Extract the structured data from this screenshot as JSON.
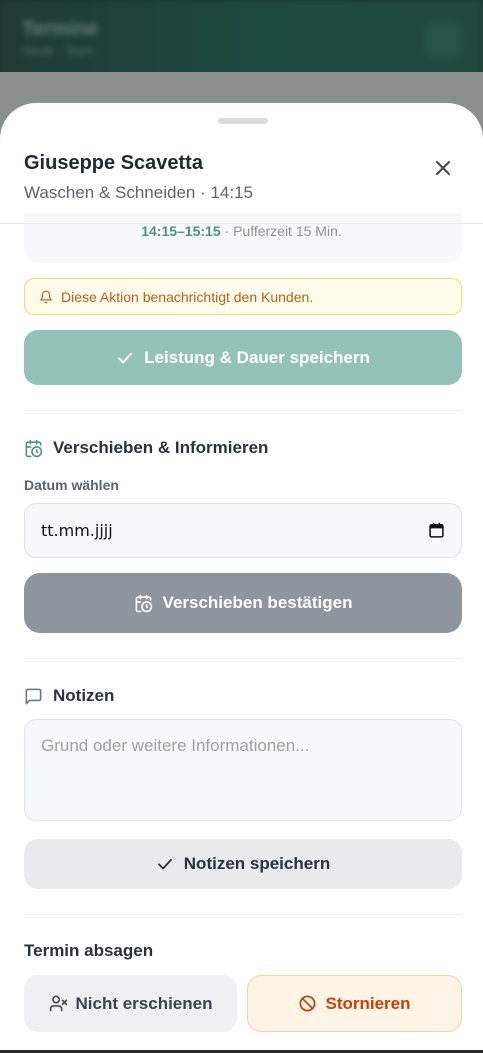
{
  "background": {
    "title": "Termine",
    "subtitle": "Heute · Team"
  },
  "sheet": {
    "title": "Giuseppe Scavetta",
    "subtitle": "Waschen & Schneiden · 14:15"
  },
  "service": {
    "time_range": "14:15–15:15",
    "buffer": " · Pufferzeit 15 Min.",
    "notice": "Diese Aktion benachrichtigt den Kunden.",
    "save_label": "Leistung & Dauer speichern"
  },
  "reschedule": {
    "title": "Verschieben & Informieren",
    "date_label": "Datum wählen",
    "date_placeholder": "tt.mm.jjjj",
    "confirm_label": "Verschieben bestätigen"
  },
  "notes": {
    "title": "Notizen",
    "placeholder": "Grund oder weitere Informationen...",
    "save_label": "Notizen speichern"
  },
  "cancel": {
    "title": "Termin absagen",
    "no_show_label": "Nicht erschienen",
    "cancel_label": "Stornieren"
  },
  "colors": {
    "accent": "#4b9480",
    "accent_disabled": "#94c1b8",
    "warning_text": "#b5611f",
    "danger_text": "#c2410c"
  }
}
